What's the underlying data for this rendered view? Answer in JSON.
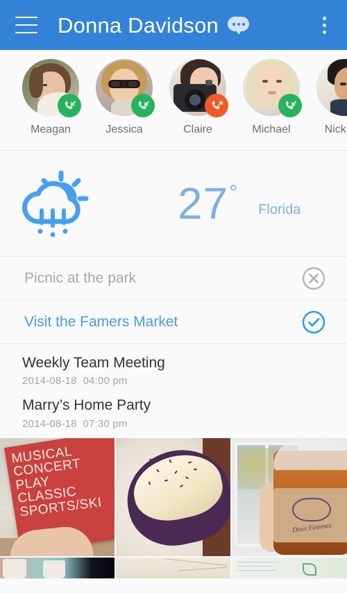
{
  "header": {
    "menu_icon": "hamburger-menu-icon",
    "title": "Donna Davidson",
    "message_icon": "chat-bubble-icon",
    "overflow_icon": "more-vertical-icon"
  },
  "contacts": {
    "items": [
      {
        "name": "Meagan",
        "call_type": "incoming",
        "call_icon": "phone-incoming-icon"
      },
      {
        "name": "Jessica",
        "call_type": "incoming",
        "call_icon": "phone-incoming-icon"
      },
      {
        "name": "Claire",
        "call_type": "outgoing",
        "call_icon": "phone-outgoing-icon"
      },
      {
        "name": "Michael",
        "call_type": "incoming",
        "call_icon": "phone-incoming-icon"
      },
      {
        "name": "Nick Sla",
        "call_type": "incoming",
        "call_icon": "phone-incoming-icon"
      }
    ]
  },
  "weather": {
    "icon": "sun-behind-rain-cloud-icon",
    "temperature": "27",
    "degree_symbol": "°",
    "location": "Florida",
    "accent_color": "#80aee4"
  },
  "tasks": {
    "items": [
      {
        "label": "Picnic at the park",
        "state": "dismissed",
        "mark_icon": "circle-x-icon",
        "color": "#a8a8a8"
      },
      {
        "label": "Visit the Famers Market",
        "state": "completed",
        "mark_icon": "circle-check-icon",
        "color": "#4a9ae4"
      }
    ]
  },
  "events": {
    "items": [
      {
        "title": "Weekly Team Meeting",
        "date": "2014-08-18",
        "time": "04:00 pm"
      },
      {
        "title": "Marry’s Home Party",
        "date": "2014-08-18",
        "time": "07:30 pm"
      }
    ]
  },
  "gallery": {
    "photos": [
      {
        "alt": "red event card held in hand",
        "card_lines": [
          "MUSICAL",
          "CONCERT",
          "PLAY",
          "CLASSIC",
          "SPORTS/SKI"
        ]
      },
      {
        "alt": "cupcake with cream frosting and sprinkles"
      },
      {
        "alt": "iced tea cup with paper sleeve",
        "sleeve_text": "Deux Femmes"
      },
      {
        "alt": "paper cups of hot chocolate"
      },
      {
        "alt": "blank paper sheets on table"
      },
      {
        "alt": "handwritten notes with green leaf drawing"
      }
    ]
  },
  "colors": {
    "appbar": "#3283d8",
    "page_background": "#fafafa",
    "incoming_call": "#27b35e",
    "outgoing_call": "#f05a28"
  }
}
